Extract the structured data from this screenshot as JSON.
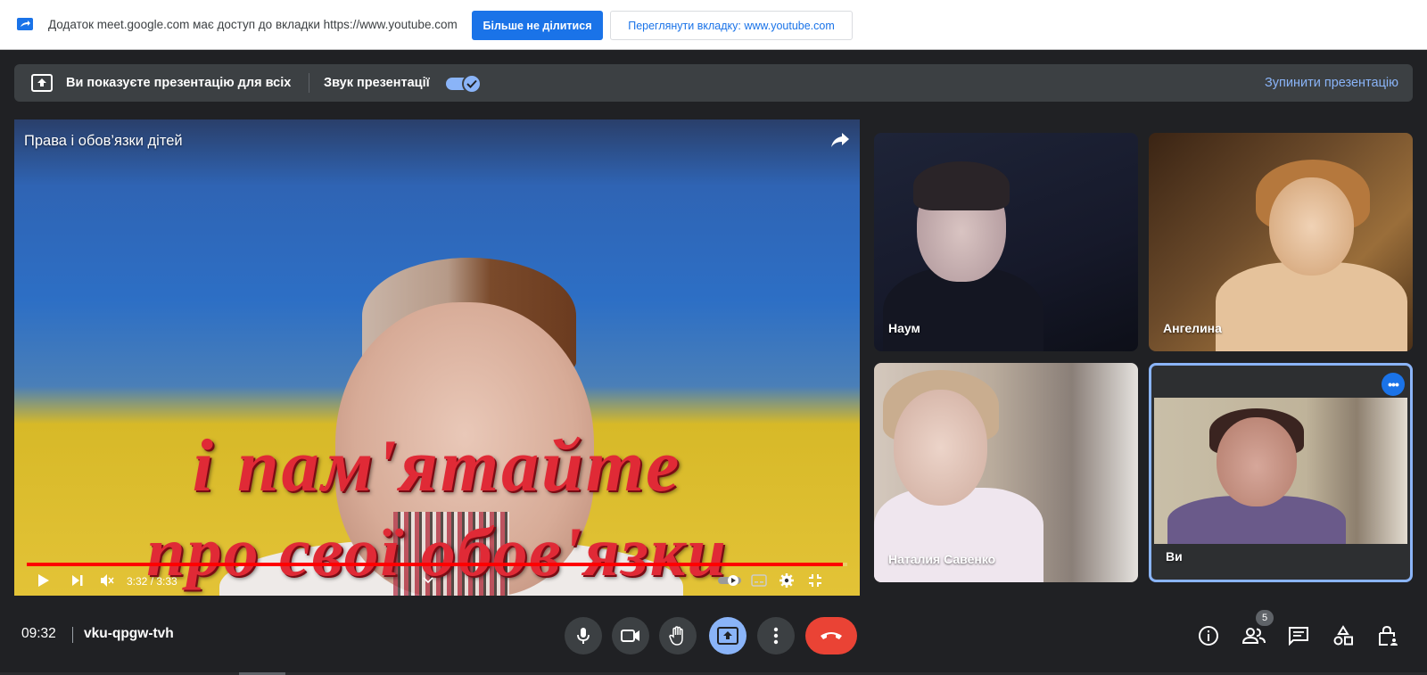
{
  "sharebar": {
    "message": "Додаток meet.google.com має доступ до вкладки https://www.youtube.com",
    "stop_sharing_label": "Більше не ділитися",
    "view_tab_label": "Переглянути вкладку: www.youtube.com",
    "icon": "tab-share-icon"
  },
  "banner": {
    "presenting_text": "Ви показуєте презентацію для всіх",
    "audio_label": "Звук презентації",
    "audio_enabled": true,
    "stop_label": "Зупинити презентацію"
  },
  "video": {
    "title": "Права і обов’язки дітей",
    "caption_line1": "і пам'ятайте",
    "caption_line2": "про свої обов'язки",
    "time": "3:32 / 3:33",
    "progress_fraction": 0.995,
    "muted": true
  },
  "participants": [
    {
      "name": "Наум"
    },
    {
      "name": "Ангелина"
    },
    {
      "name": "Наталия Савенко"
    },
    {
      "name": "Ви"
    }
  ],
  "bottom": {
    "clock": "09:32",
    "meeting_code": "vku-qpgw-tvh",
    "people_count": "5"
  },
  "colors": {
    "accent": "#8ab4f8",
    "primary_button": "#1a73e8",
    "hangup": "#ea4335",
    "background": "#202124"
  }
}
